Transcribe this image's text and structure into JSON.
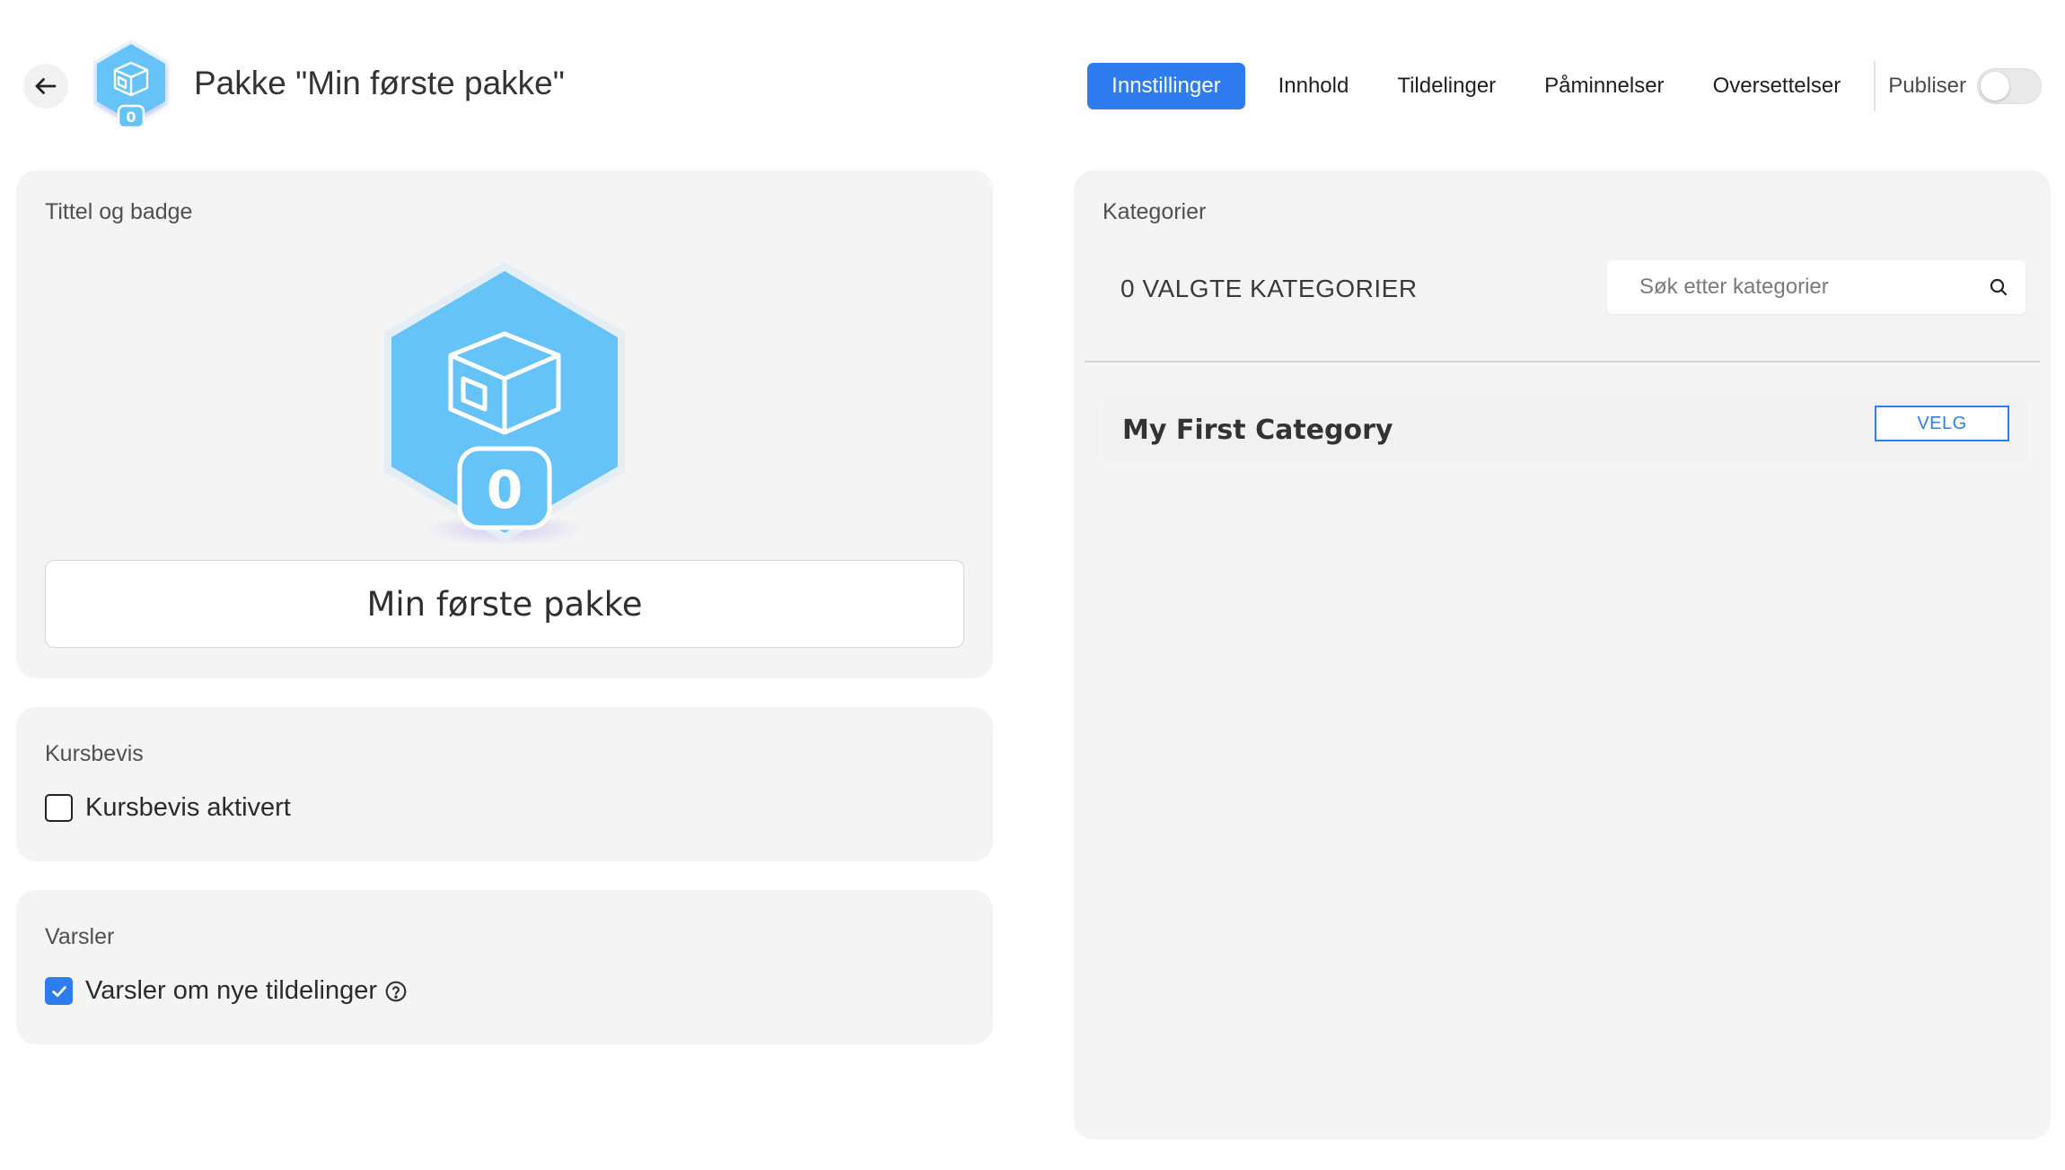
{
  "header": {
    "title": "Pakke \"Min første pakke\"",
    "badge_count": "0",
    "tabs": [
      {
        "label": "Innstillinger",
        "active": true
      },
      {
        "label": "Innhold"
      },
      {
        "label": "Tildelinger"
      },
      {
        "label": "Påminnelser"
      },
      {
        "label": "Oversettelser"
      }
    ],
    "publish_label": "Publiser",
    "publish_enabled": false
  },
  "title_badge": {
    "section_title": "Tittel og badge",
    "badge_count": "0",
    "package_name": "Min første pakke"
  },
  "certificate": {
    "section_title": "Kursbevis",
    "checkbox_label": "Kursbevis aktivert",
    "checked": false
  },
  "alerts": {
    "section_title": "Varsler",
    "checkbox_label": "Varsler om nye tildelinger",
    "checked": true
  },
  "categories": {
    "section_title": "Kategorier",
    "selected_count": "0 VALGTE KATEGORIER",
    "search_placeholder": "Søk etter kategorier",
    "items": [
      {
        "name": "My First Category",
        "action_label": "VELG"
      }
    ]
  },
  "colors": {
    "accent": "#2f7cf0",
    "badge_fill": "#66c3f8",
    "card_bg": "#f4f4f4"
  }
}
